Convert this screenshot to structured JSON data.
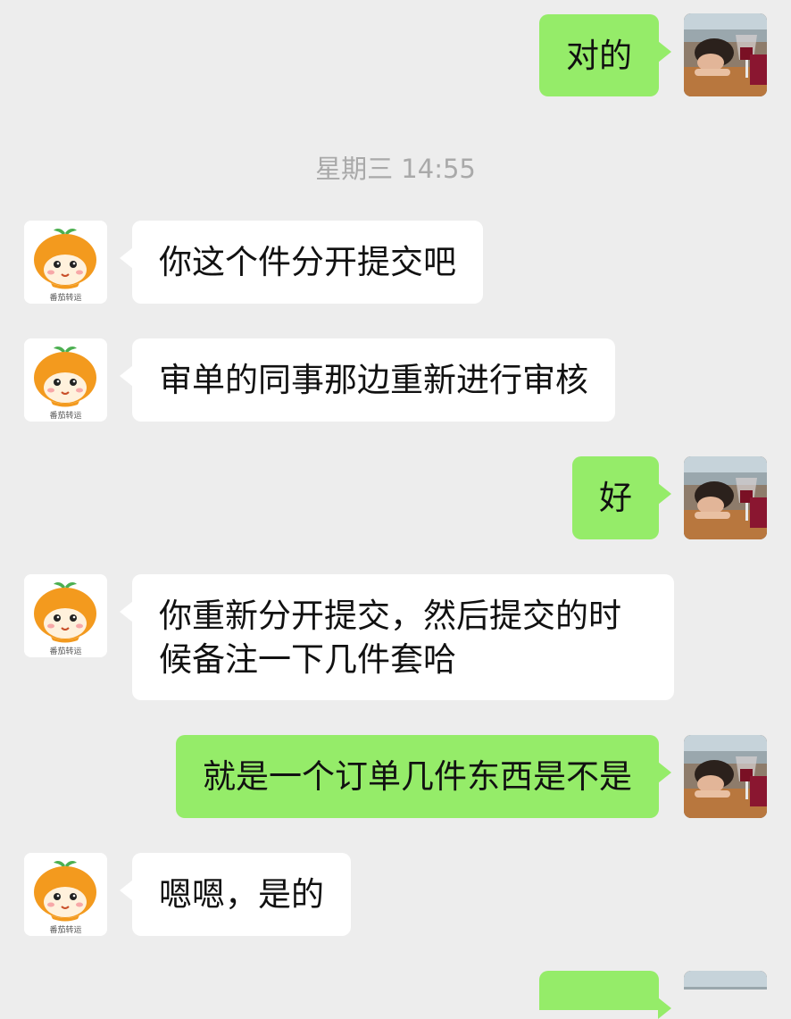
{
  "chat": {
    "timestamp": "星期三 14:55",
    "messages": [
      {
        "from": "me",
        "text": "对的"
      },
      {
        "from": "merchant",
        "text": "你这个件分开提交吧"
      },
      {
        "from": "merchant",
        "text": "审单的同事那边重新进行审核"
      },
      {
        "from": "me",
        "text": "好"
      },
      {
        "from": "merchant",
        "text": "你重新分开提交，然后提交的时候备注一下几件套哈"
      },
      {
        "from": "me",
        "text": "就是一个订单几件东西是不是"
      },
      {
        "from": "merchant",
        "text": "嗯嗯，是的"
      },
      {
        "from": "me",
        "text": ""
      }
    ],
    "merchant_avatar": {
      "brand_text": "番茄转运",
      "icon": "orange-mascot-icon"
    },
    "my_avatar": {
      "icon": "user-photo-avatar"
    },
    "colors": {
      "background": "#ededed",
      "outgoing": "#95ec69",
      "incoming": "#ffffff",
      "timestamp": "#a9a9a9"
    }
  }
}
